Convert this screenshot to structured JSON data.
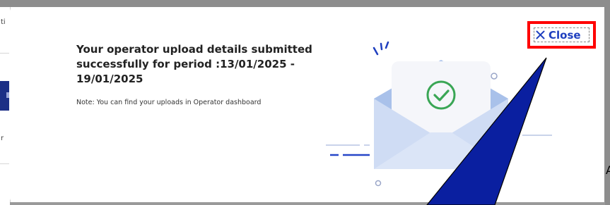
{
  "modal": {
    "title": "Your operator upload details submitted successfully for period :13/01/2025 - 19/01/2025",
    "note": "Note: You can find your uploads in Operator dashboard",
    "close_label": "Close",
    "close_icon": "close-icon",
    "illustration_icon": "envelope-check-icon"
  },
  "background": {
    "fragment_1": "ti",
    "fragment_2": "r"
  },
  "annotation": {
    "highlight_color": "#ff0000",
    "pointer_color": "#0a1fa0",
    "edge_text": "A"
  },
  "colors": {
    "accent": "#1f3fbf",
    "success": "#3aa655",
    "envelope": "#cfdcf4"
  }
}
